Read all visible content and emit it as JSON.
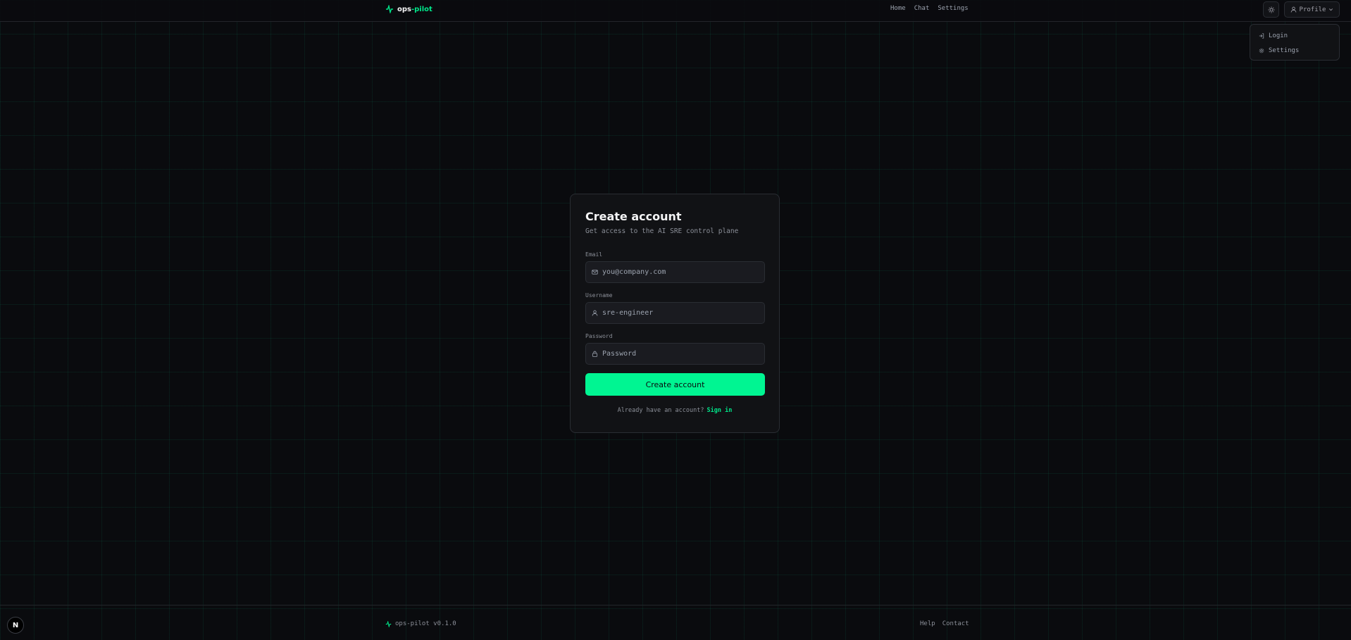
{
  "header": {
    "logo": {
      "prefix": "ops",
      "accent": "-pilot"
    },
    "nav": [
      "Home",
      "Chat",
      "Settings"
    ],
    "profile_label": "Profile"
  },
  "dropdown": {
    "items": [
      {
        "label": "Login",
        "icon": "login-icon"
      },
      {
        "label": "Settings",
        "icon": "gear-icon"
      }
    ]
  },
  "form": {
    "title": "Create account",
    "subtitle": "Get access to the AI SRE control plane",
    "email": {
      "label": "Email",
      "placeholder": "you@company.com",
      "value": ""
    },
    "username": {
      "label": "Username",
      "placeholder": "sre-engineer",
      "value": ""
    },
    "password": {
      "label": "Password",
      "placeholder": "Password",
      "value": ""
    },
    "submit_label": "Create account",
    "signin_prompt": "Already have an account?",
    "signin_link": "Sign in"
  },
  "footer": {
    "brand": "ops-pilot v0.1.0",
    "links": [
      "Help",
      "Contact"
    ]
  },
  "badge": "N",
  "colors": {
    "accent": "#00f592",
    "background": "#0a0b0e",
    "card": "#111215"
  }
}
